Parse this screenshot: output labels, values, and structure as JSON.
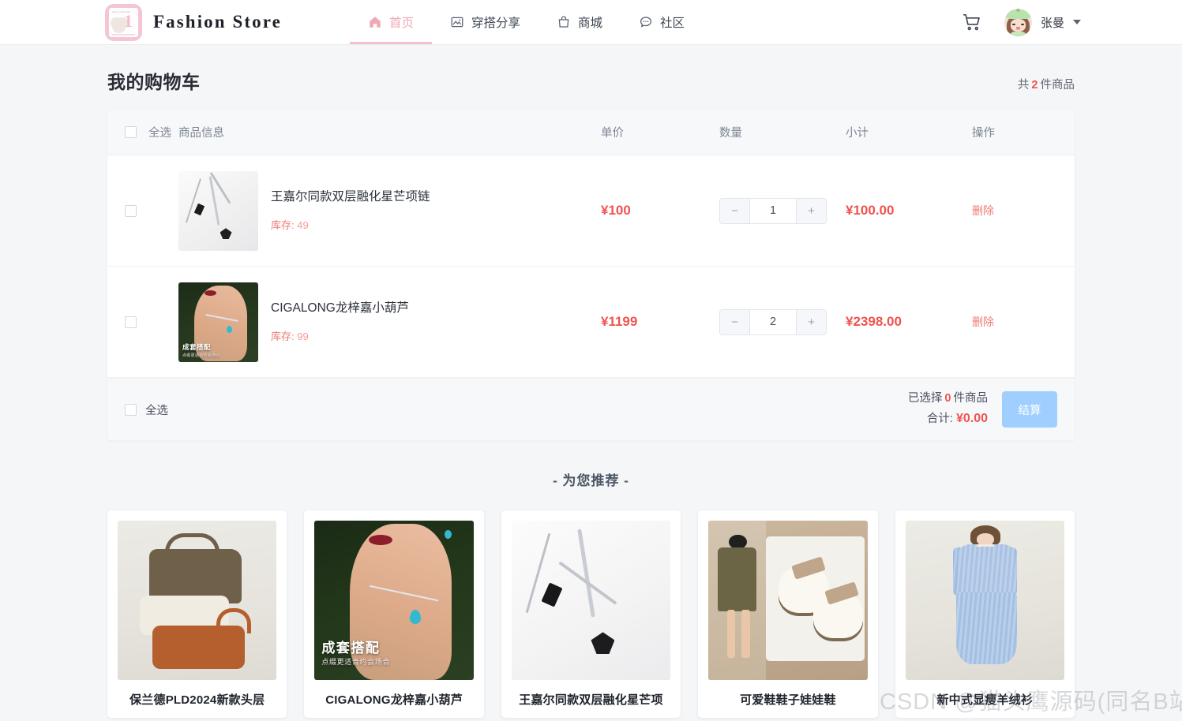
{
  "header": {
    "brand_name": "Fashion Store",
    "logo_caption": "Happy Birthday",
    "logo_number": "1",
    "nav": [
      {
        "label": "首页",
        "icon": "home-icon",
        "active": true
      },
      {
        "label": "穿搭分享",
        "icon": "image-icon",
        "active": false
      },
      {
        "label": "商城",
        "icon": "shop-bag-icon",
        "active": false
      },
      {
        "label": "社区",
        "icon": "chat-icon",
        "active": false
      }
    ],
    "cart_icon": "shopping-cart-icon",
    "user": {
      "name": "张曼",
      "avatar": "user-avatar",
      "caret": "chevron-down-icon"
    }
  },
  "page": {
    "title": "我的购物车",
    "count_prefix": "共",
    "count_value": "2",
    "count_suffix": "件商品"
  },
  "cart": {
    "columns": {
      "select_all": "全选",
      "product": "商品信息",
      "unit_price": "单价",
      "quantity": "数量",
      "subtotal": "小计",
      "action": "操作"
    },
    "stock_label": "库存:",
    "minus_label": "−",
    "plus_label": "+",
    "delete_label": "删除",
    "items": [
      {
        "name": "王嘉尔同款双层融化星芒项链",
        "stock": "49",
        "unit_price": "¥100",
        "quantity": "1",
        "subtotal": "¥100.00",
        "image": "necklace-silver-star-photo",
        "checked": false
      },
      {
        "name": "CIGALONG龙梓嘉小葫芦",
        "stock": "99",
        "unit_price": "¥1199",
        "quantity": "2",
        "subtotal": "¥2398.00",
        "image": "model-necklace-photo",
        "image_overlay_title": "成套搭配",
        "image_overlay_sub": "点缀更适合约会场合",
        "checked": false
      }
    ],
    "footer": {
      "select_all": "全选",
      "selected_prefix": "已选择",
      "selected_count": "0",
      "selected_suffix": "件商品",
      "total_label": "合计:",
      "total_value": "¥0.00",
      "checkout_label": "结算",
      "checkout_color": "#a0cfff"
    }
  },
  "recommendations": {
    "title": "- 为您推荐 -",
    "cards": [
      {
        "name": "保兰德PLD2024新款头层",
        "image": "handbags-stack-photo"
      },
      {
        "name": "CIGALONG龙梓嘉小葫芦",
        "image": "model-necklace-photo",
        "overlay_title": "成套搭配",
        "overlay_sub": "点缀更适合约会场合"
      },
      {
        "name": "王嘉尔同款双层融化星芒项",
        "image": "necklace-silver-star-photo"
      },
      {
        "name": "可爱鞋鞋子娃娃鞋",
        "image": "mary-jane-shoes-photo"
      },
      {
        "name": "新中式显瘦羊绒衫",
        "image": "blue-knit-dress-photo"
      }
    ]
  },
  "watermark": "CSDN @猫头鹰源码(同名B站)",
  "colors": {
    "accent_pink": "#f4c2cc",
    "price_red": "#ef5350",
    "checkout_blue": "#a0cfff",
    "page_bg": "#f5f6f8"
  }
}
